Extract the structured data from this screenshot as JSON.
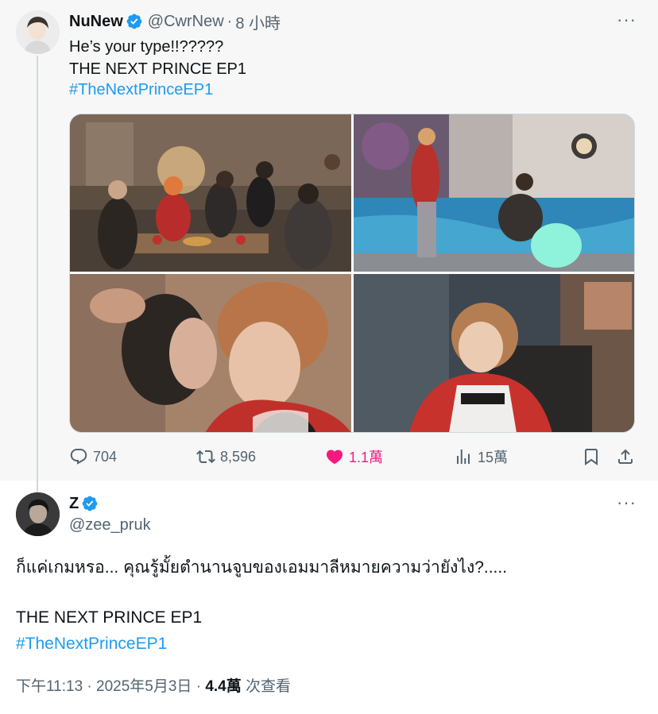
{
  "parent_tweet": {
    "display_name": "NuNew",
    "handle": "@CwrNew",
    "separator": "·",
    "time": "8 小時",
    "text": "He’s your type!!?????\nTHE NEXT PRINCE EP1",
    "hashtag": "#TheNextPrinceEP1",
    "stats": {
      "replies": "704",
      "reposts": "8,596",
      "likes": "1.1萬",
      "views": "15萬"
    },
    "liked": true
  },
  "main_tweet": {
    "display_name": "Z",
    "handle": "@zee_pruk",
    "text": "ก็แค่เกมหรอ... คุณรู้มั้ยตำนานจูบของเอมมาลีหมายความว่ายังไง?.....",
    "show_line": "THE NEXT PRINCE EP1",
    "hashtag": "#TheNextPrinceEP1",
    "timestamp": "下午11:13 · 2025年5月3日 · ",
    "views_count": "4.4萬",
    "views_label": " 次查看"
  },
  "icons": {
    "verified": "verified-badge-icon",
    "more": "more-options-icon",
    "reply": "reply-icon",
    "repost": "repost-icon",
    "like": "heart-icon",
    "views": "views-chart-icon",
    "bookmark": "bookmark-icon",
    "share": "share-icon"
  },
  "colors": {
    "accent_blue": "#1d9bf0",
    "like_pink": "#f91880",
    "secondary_text": "#536471",
    "primary_text": "#0f1419",
    "parent_bg": "#f7f7f7"
  }
}
